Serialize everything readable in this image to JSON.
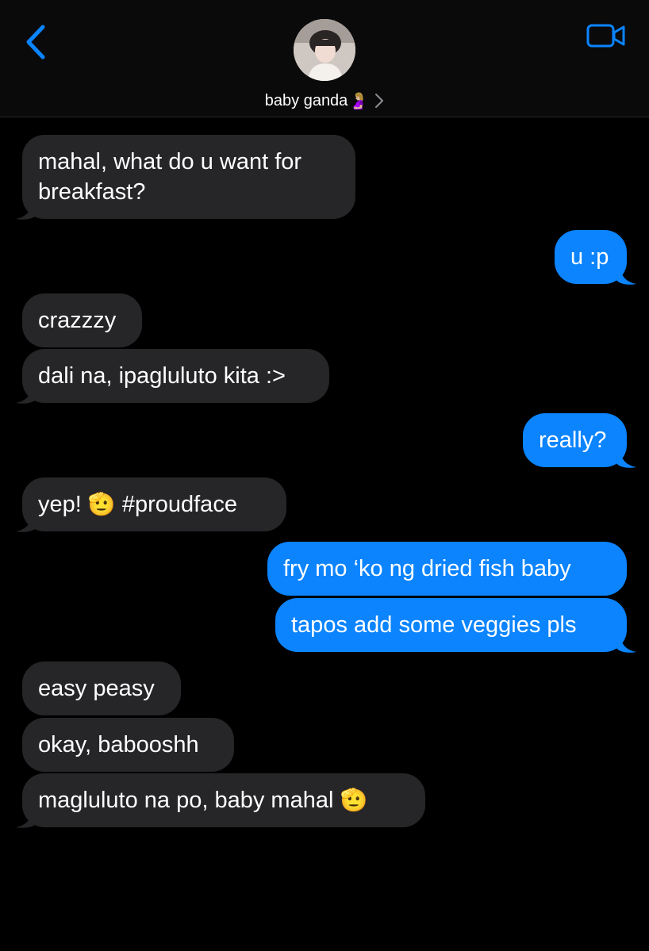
{
  "header": {
    "contact_name": "baby ganda",
    "contact_emoji": "🤰🏼",
    "icons": {
      "back": "chevron-left-icon",
      "video": "video-camera-icon",
      "details": "chevron-right-icon",
      "avatar": "contact-avatar"
    },
    "accent_color": "#0b84fe"
  },
  "messages": [
    {
      "from": "them",
      "text": "mahal, what do u want for breakfast?",
      "line1": "mahal, what do u want for",
      "line2": "breakfast?"
    },
    {
      "from": "me",
      "text": "u :p"
    },
    {
      "from": "them",
      "text": "crazzzy"
    },
    {
      "from": "them",
      "text": "dali na, ipagluluto kita :>"
    },
    {
      "from": "me",
      "text": "really?"
    },
    {
      "from": "them",
      "text_before": "yep!",
      "emoji": "🫡",
      "text_after": "#proudface"
    },
    {
      "from": "me",
      "text": "fry mo ‘ko ng dried fish baby"
    },
    {
      "from": "me",
      "text": "tapos add some veggies pls"
    },
    {
      "from": "them",
      "text": "easy peasy"
    },
    {
      "from": "them",
      "text": "okay, babooshh"
    },
    {
      "from": "them",
      "text_before": "magluluto na po, baby mahal",
      "emoji": "🫡"
    }
  ],
  "colors": {
    "incoming_bubble": "#262629",
    "outgoing_bubble": "#0b84fe",
    "background": "#000000"
  }
}
